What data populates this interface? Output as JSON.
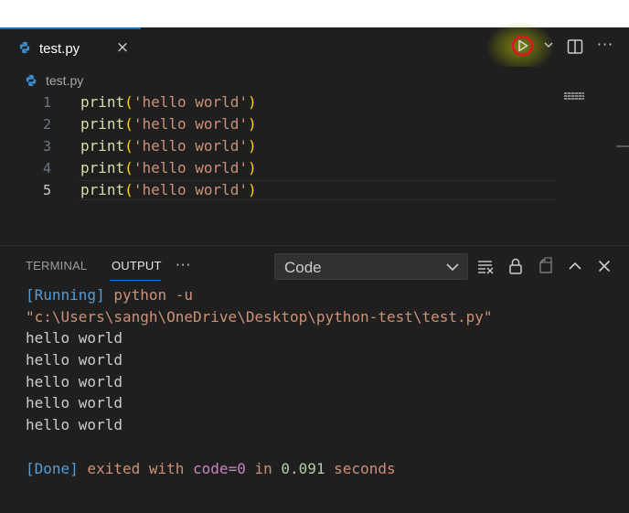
{
  "tab": {
    "label": "test.py",
    "close_glyph": "×"
  },
  "toolbar": {
    "run_icon": "play-icon",
    "more_glyph": "···"
  },
  "breadcrumb": {
    "file": "test.py"
  },
  "editor": {
    "lines": [
      {
        "number": "1",
        "fn": "print",
        "open": "(",
        "str": "'hello world'",
        "close": ")"
      },
      {
        "number": "2",
        "fn": "print",
        "open": "(",
        "str": "'hello world'",
        "close": ")"
      },
      {
        "number": "3",
        "fn": "print",
        "open": "(",
        "str": "'hello world'",
        "close": ")"
      },
      {
        "number": "4",
        "fn": "print",
        "open": "(",
        "str": "'hello world'",
        "close": ")"
      },
      {
        "number": "5",
        "fn": "print",
        "open": "(",
        "str": "'hello world'",
        "close": ")"
      }
    ],
    "active_line": "5"
  },
  "panel": {
    "tabs": [
      {
        "label": "TERMINAL"
      },
      {
        "label": "OUTPUT"
      }
    ],
    "more_glyph": "···",
    "select_value": "Code"
  },
  "output": {
    "running_tag": "[Running]",
    "command": " python -u",
    "path": "\"c:\\Users\\sangh\\OneDrive\\Desktop\\python-test\\test.py\"",
    "lines": [
      "hello world",
      "hello world",
      "hello world",
      "hello world",
      "hello world"
    ],
    "done_tag": "[Done]",
    "exited_with": " exited with ",
    "code_kw": "code=0",
    "in_word": " in ",
    "seconds_value": "0.091",
    "seconds_word": " seconds"
  },
  "colors": {
    "accent": "#0078d4",
    "run_annotation": "#e81123",
    "background": "#1f1f1f"
  }
}
